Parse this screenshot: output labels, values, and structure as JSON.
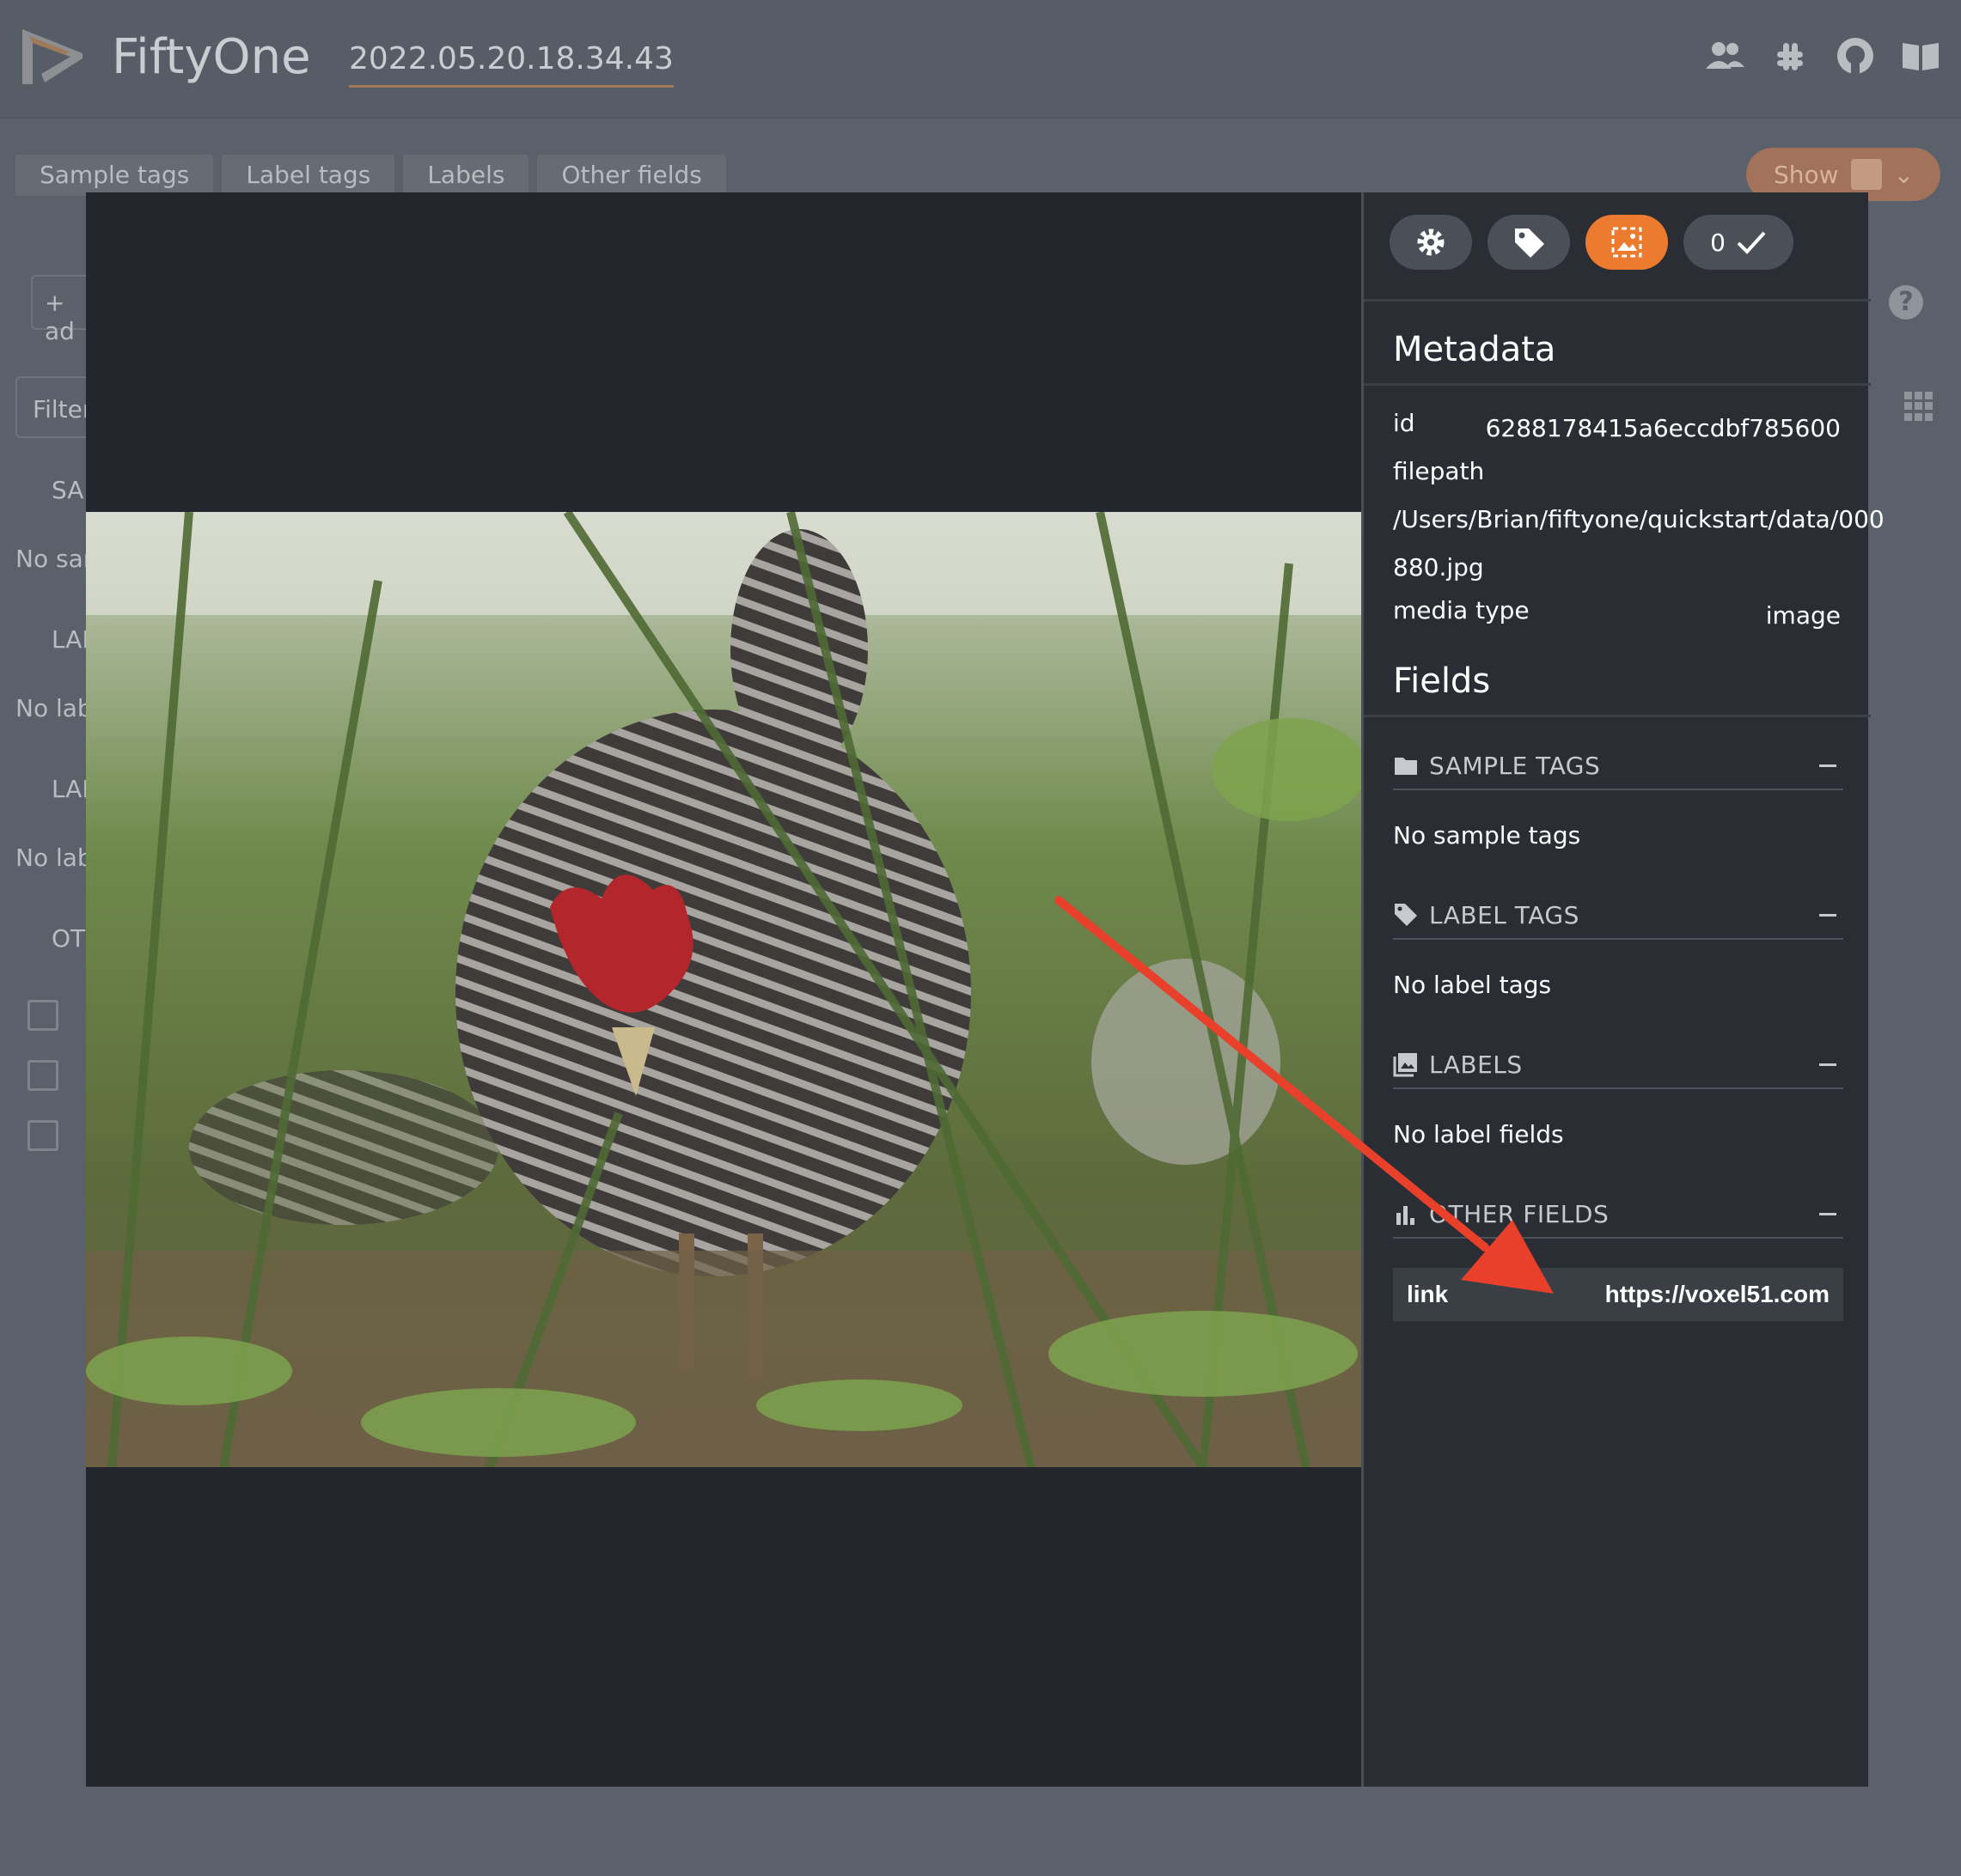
{
  "app": {
    "title": "FiftyOne",
    "dataset": "2022.05.20.18.34.43"
  },
  "filter_tabs": [
    "Sample tags",
    "Label tags",
    "Labels",
    "Other fields"
  ],
  "show_button": "Show",
  "left_panel": {
    "add_stage": "+ ad",
    "filter": "Filter",
    "sample_tags_header": "SAM",
    "no_sample": "No sam",
    "label_tags_header": "LAB",
    "no_label_1": "No labe",
    "labels_header": "LAB",
    "no_label_2": "No labe",
    "other_header": "OTI"
  },
  "colors": {
    "accent": "#ec7b2f",
    "arrow": "#e8402a"
  },
  "sidebar": {
    "buttons": [
      "gear-icon",
      "tag-icon",
      "image-select-icon"
    ],
    "count_value": "0",
    "metadata": {
      "title": "Metadata",
      "id_label": "id",
      "id_value": "6288178415a6eccdbf785600",
      "filepath_label": "filepath",
      "filepath_line1": "/Users/Brian/fiftyone/quickstart/data/000",
      "filepath_line2": "880.jpg",
      "media_type_label": "media type",
      "media_type_value": "image"
    },
    "fields": {
      "title": "Fields",
      "sample_tags": "SAMPLE TAGS",
      "no_sample_tags": "No sample tags",
      "label_tags": "LABEL TAGS",
      "no_label_tags": "No label tags",
      "labels": "LABELS",
      "no_label_fields": "No label fields",
      "other_fields": "OTHER FIELDS",
      "link_key": "link",
      "link_value": "https://voxel51.com"
    }
  }
}
